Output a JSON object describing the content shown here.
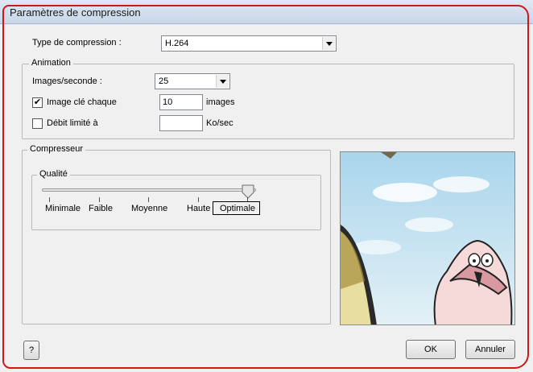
{
  "window": {
    "title": "Paramètres de compression"
  },
  "compression_type": {
    "label": "Type de compression :",
    "value": "H.264"
  },
  "animation": {
    "group_label": "Animation",
    "fps_label": "Images/seconde :",
    "fps_value": "25",
    "keyframe": {
      "label": "Image clé chaque",
      "checked": true,
      "value": "10",
      "unit": "images"
    },
    "datarate": {
      "label": "Débit limité à",
      "checked": false,
      "value": "",
      "unit": "Ko/sec"
    }
  },
  "compressor": {
    "group_label": "Compresseur",
    "quality": {
      "group_label": "Qualité",
      "ticks": [
        "Minimale",
        "Faible",
        "Moyenne",
        "Haute",
        "Optimale"
      ],
      "selected": "Optimale"
    }
  },
  "buttons": {
    "help": "?",
    "ok": "OK",
    "cancel": "Annuler"
  },
  "colors": {
    "accent_outline": "#d01818",
    "sky": "#cfe6f3"
  }
}
